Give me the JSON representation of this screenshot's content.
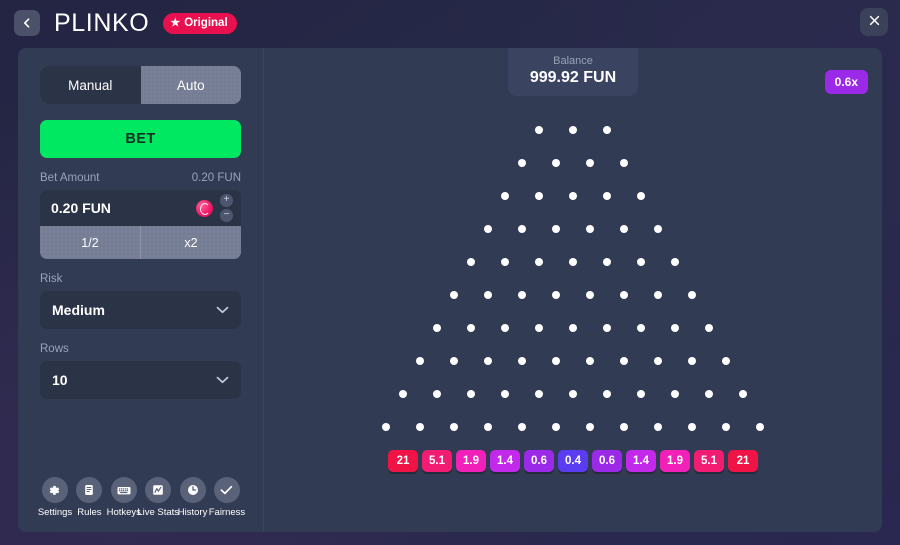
{
  "topbar": {
    "back_icon": "chevron-left-icon",
    "title": "PLINKO",
    "badge_label": "Original",
    "badge_star": "★",
    "badge_color": "#e8104f",
    "close_icon": "close-icon"
  },
  "sidebar": {
    "modes": [
      {
        "label": "Manual",
        "active": true
      },
      {
        "label": "Auto",
        "active": false
      }
    ],
    "bet_button_label": "BET",
    "bet_button_color": "#00e762",
    "bet_amount": {
      "label": "Bet Amount",
      "display_value": "0.20 FUN",
      "input_value": "0.20 FUN",
      "currency_icon": "fun-coin-icon",
      "increment_label": "+",
      "decrement_label": "−"
    },
    "quick_buttons": [
      {
        "label": "1/2"
      },
      {
        "label": "x2"
      }
    ],
    "risk": {
      "label": "Risk",
      "value": "Medium",
      "chevron": "chevron-down-icon"
    },
    "rows": {
      "label": "Rows",
      "value": "10",
      "chevron": "chevron-down-icon"
    },
    "tools": [
      {
        "label": "Settings",
        "icon": "gear-icon"
      },
      {
        "label": "Rules",
        "icon": "document-icon"
      },
      {
        "label": "Hotkeys",
        "icon": "keyboard-icon"
      },
      {
        "label": "Live Stats",
        "icon": "chart-icon"
      },
      {
        "label": "History",
        "icon": "clock-icon"
      },
      {
        "label": "Fairness",
        "icon": "check-icon"
      }
    ]
  },
  "game": {
    "balance_label": "Balance",
    "balance_value": "999.92 FUN",
    "recent_multiplier": "0.6x",
    "recent_multiplier_color": "#9b2ae8",
    "peg_rows": [
      3,
      4,
      5,
      6,
      7,
      8,
      9,
      10,
      11,
      12
    ],
    "buckets": [
      {
        "label": "21",
        "color": "#f01446"
      },
      {
        "label": "5.1",
        "color": "#f21d72"
      },
      {
        "label": "1.9",
        "color": "#f020b8"
      },
      {
        "label": "1.4",
        "color": "#c229ea"
      },
      {
        "label": "0.6",
        "color": "#9b2ae8"
      },
      {
        "label": "0.4",
        "color": "#5a3df0"
      },
      {
        "label": "0.6",
        "color": "#9b2ae8"
      },
      {
        "label": "1.4",
        "color": "#c229ea"
      },
      {
        "label": "1.9",
        "color": "#f020b8"
      },
      {
        "label": "5.1",
        "color": "#f21d72"
      },
      {
        "label": "21",
        "color": "#f01446"
      }
    ]
  }
}
